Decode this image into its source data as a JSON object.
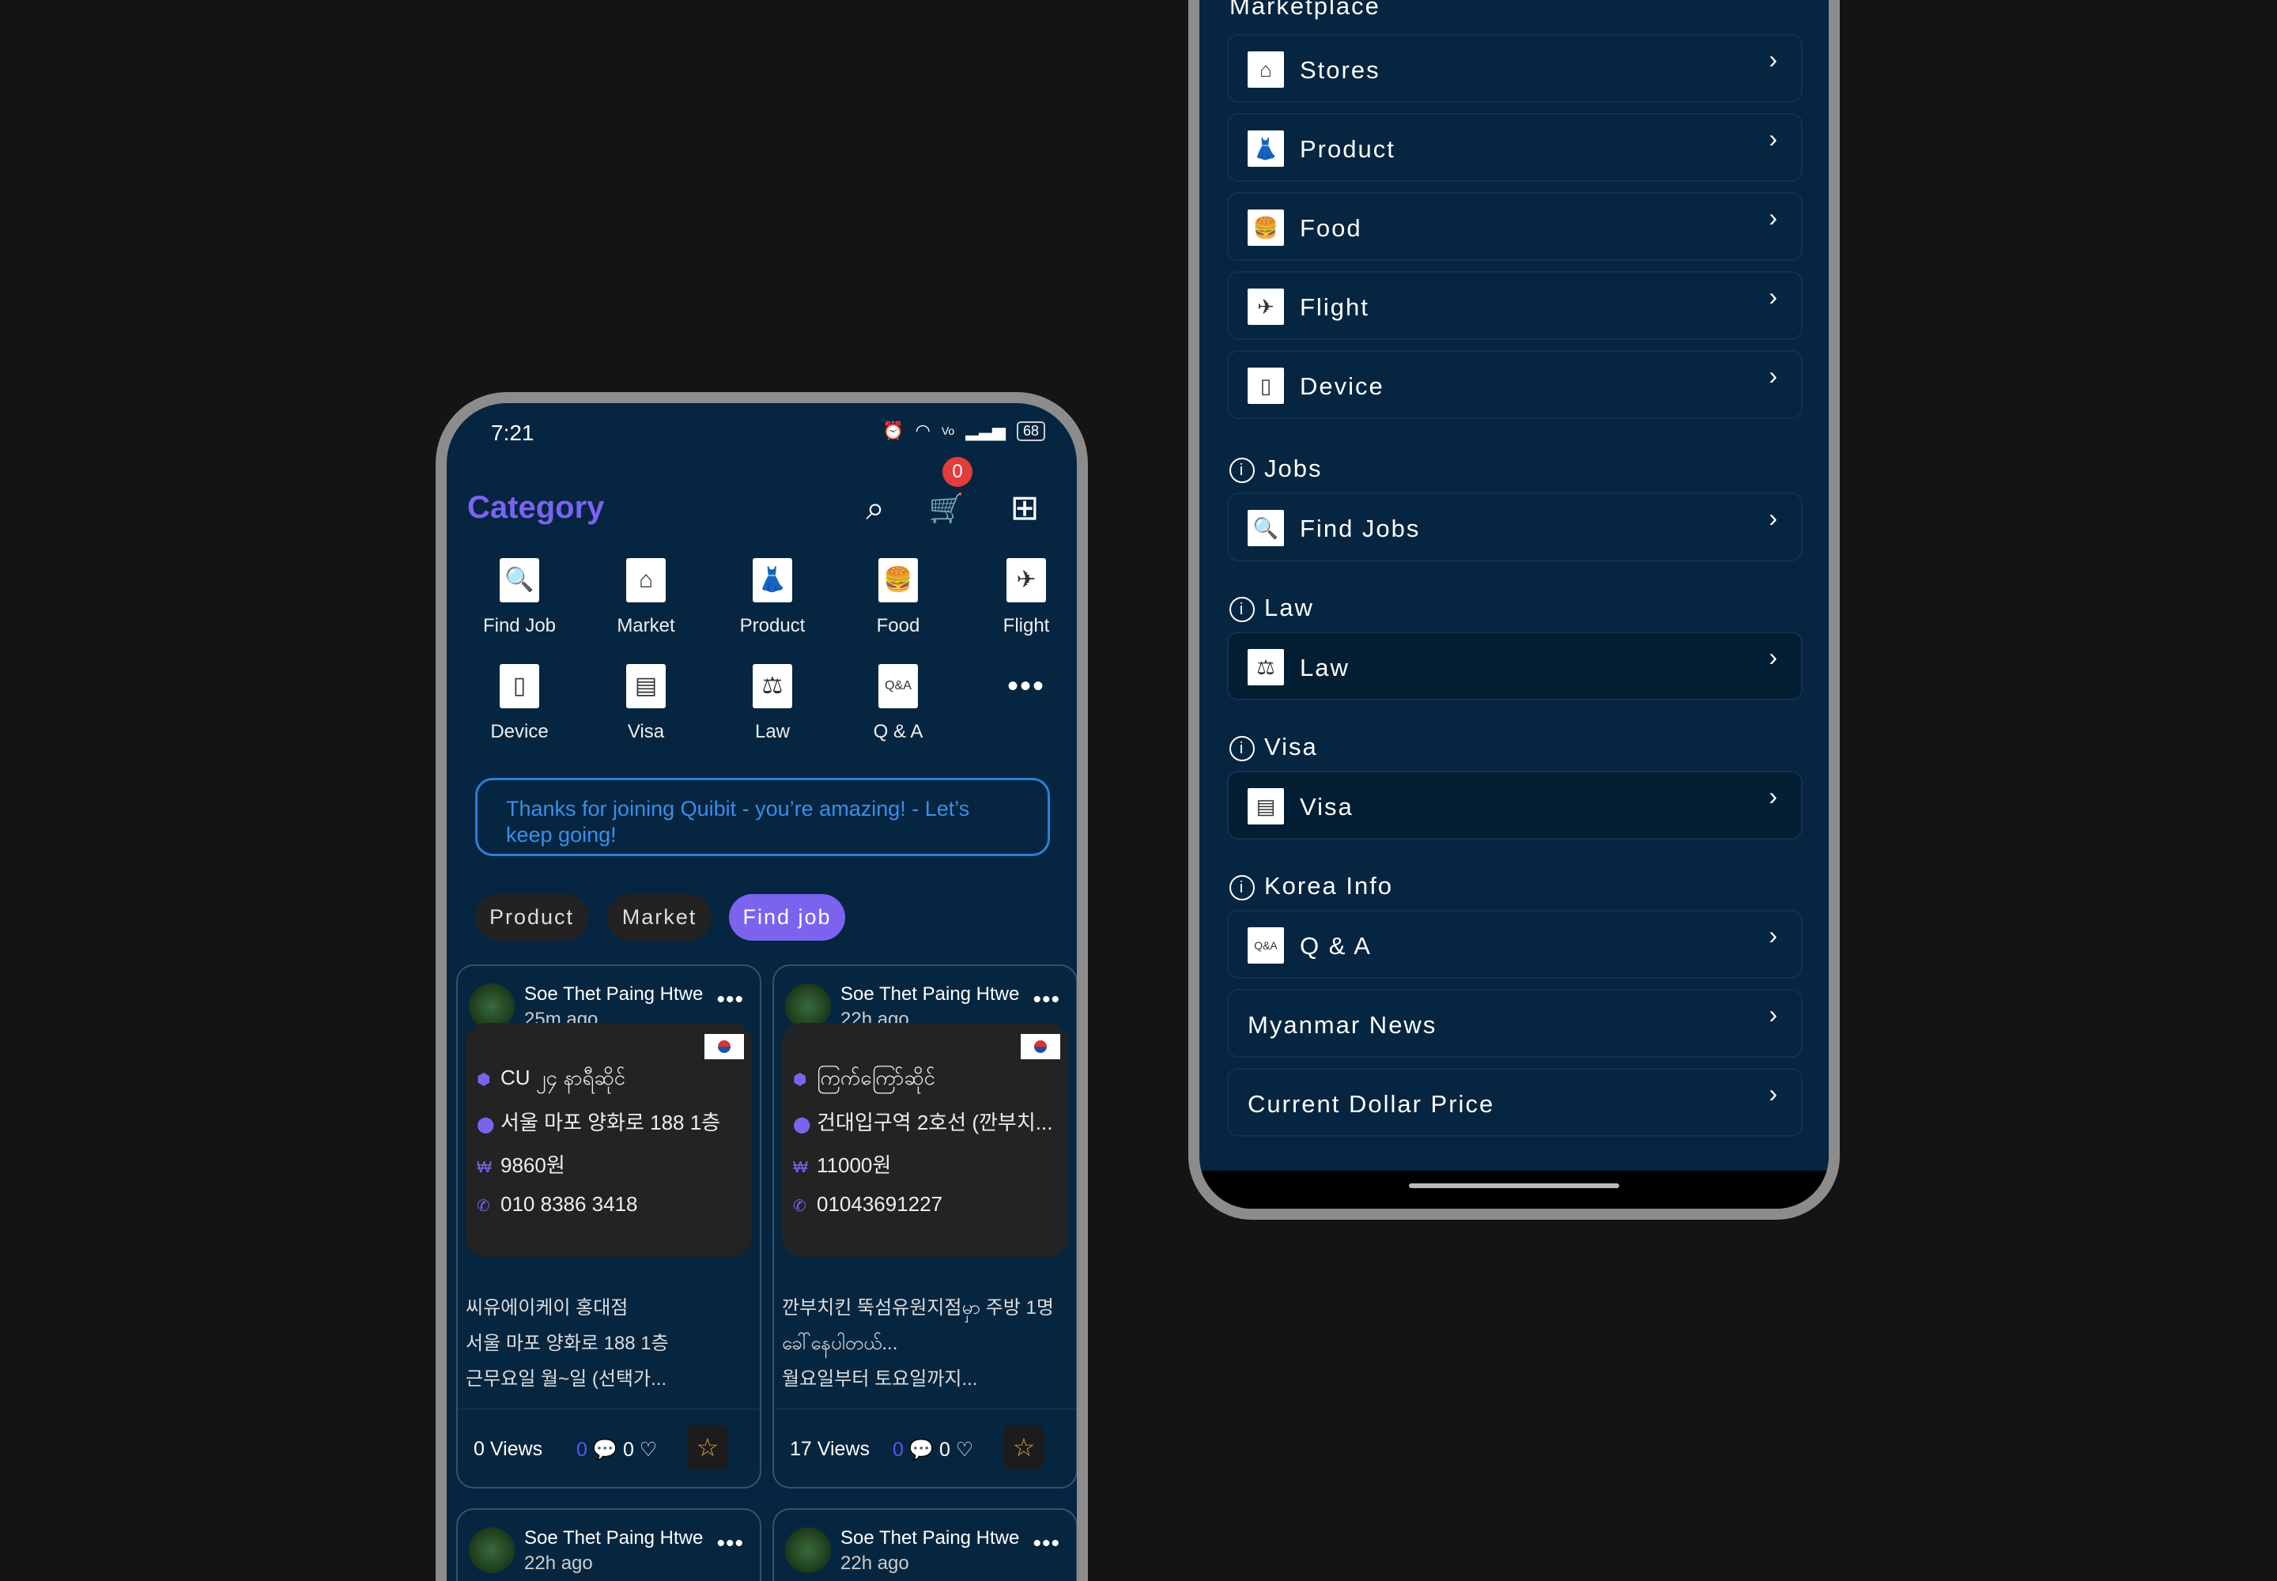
{
  "status": {
    "time": "7:21",
    "battery": "68",
    "icons": [
      "alarm-icon",
      "wifi-icon",
      "volte-icon",
      "signal-icon",
      "battery-icon"
    ]
  },
  "header": {
    "title": "Category",
    "cart_count": "0"
  },
  "categories": [
    {
      "label": "Find Job",
      "icon": "find-job-icon",
      "glyph": "🔍"
    },
    {
      "label": "Market",
      "icon": "market-icon",
      "glyph": "⌂"
    },
    {
      "label": "Product",
      "icon": "product-icon",
      "glyph": "👗"
    },
    {
      "label": "Food",
      "icon": "food-icon",
      "glyph": "🍔"
    },
    {
      "label": "Flight",
      "icon": "flight-icon",
      "glyph": "✈"
    },
    {
      "label": "Device",
      "icon": "device-icon",
      "glyph": "▯"
    },
    {
      "label": "Visa",
      "icon": "visa-icon",
      "glyph": "▤"
    },
    {
      "label": "Law",
      "icon": "law-icon",
      "glyph": "⚖"
    },
    {
      "label": "Q & A",
      "icon": "qa-icon",
      "glyph": "Q&A"
    }
  ],
  "more": "•••",
  "banner": "Thanks for joining Quibit - you’re amazing! - Let’s keep going!",
  "chips": [
    {
      "label": "Product",
      "active": false
    },
    {
      "label": "Market",
      "active": false
    },
    {
      "label": "Find job",
      "active": true
    }
  ],
  "cards": [
    {
      "author": "Soe Thet Paing Htwe",
      "time": "25m ago",
      "title": "CU ၂၄ နာရီဆိုင်",
      "address": "서울 마포 양화로 188 1층",
      "wage": "9860원",
      "phone": "010 8386 3418",
      "desc": [
        "씨유에이케이 홍대점",
        "서울 마포 양화로 188 1층",
        "근무요일 월~일 (선택가..."
      ],
      "views": "0 Views",
      "comments": "0",
      "likes": "0"
    },
    {
      "author": "Soe Thet Paing Htwe",
      "time": "22h ago",
      "title": "ကြက်ကြော်ဆိုင်",
      "address": "건대입구역 2호선 (깐부치...",
      "wage": "11000원",
      "phone": "01043691227",
      "desc": [
        "깐부치킨 뚝섬유원지점မှာ 주방 1명",
        "ခေါ်နေပါတယ်...",
        "월요일부터 토요일까지..."
      ],
      "views": "17 Views",
      "comments": "0",
      "likes": "0"
    }
  ],
  "cards_more": [
    {
      "author": "Soe Thet Paing Htwe",
      "time": "22h ago"
    },
    {
      "author": "Soe Thet Paing Htwe",
      "time": "22h ago"
    }
  ],
  "menu": {
    "marketplace_title": "Marketplace",
    "marketplace": [
      {
        "label": "Stores",
        "glyph": "⌂"
      },
      {
        "label": "Product",
        "glyph": "👗"
      },
      {
        "label": "Food",
        "glyph": "🍔"
      },
      {
        "label": "Flight",
        "glyph": "✈"
      },
      {
        "label": "Device",
        "glyph": "▯"
      }
    ],
    "sections": [
      {
        "title": "Jobs",
        "items": [
          {
            "label": "Find Jobs",
            "glyph": "🔍"
          }
        ]
      },
      {
        "title": "Law",
        "items": [
          {
            "label": "Law",
            "glyph": "⚖",
            "dark": true
          }
        ]
      },
      {
        "title": "Visa",
        "items": [
          {
            "label": "Visa",
            "glyph": "▤",
            "dark": true
          }
        ]
      },
      {
        "title": "Korea Info",
        "items": [
          {
            "label": "Q & A",
            "glyph": "Q&A"
          },
          {
            "label": "Myanmar News"
          },
          {
            "label": "Current Dollar Price"
          }
        ]
      }
    ]
  },
  "colors": {
    "accent": "#7b63f0",
    "banner": "#2b7fd8",
    "background": "#052540",
    "badge": "#e23c3c",
    "star": "#e8a030"
  }
}
